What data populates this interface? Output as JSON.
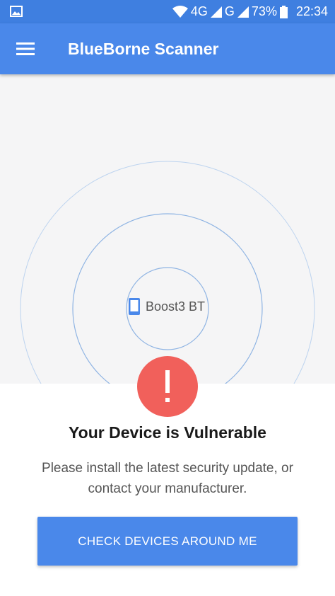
{
  "status_bar": {
    "network": "4G",
    "network2": "G",
    "battery": "73%",
    "time": "22:34",
    "icons": [
      "gallery-icon",
      "wifi-icon",
      "signal-icon",
      "battery-icon"
    ]
  },
  "app_bar": {
    "title": "BlueBorne Scanner",
    "menu_icon": "hamburger-menu-icon"
  },
  "radar": {
    "device_name": "Boost3 BT",
    "device_icon": "phone-icon"
  },
  "result": {
    "alert_icon": "exclamation-icon",
    "headline": "Your Device is Vulnerable",
    "message": "Please install the latest security update, or contact your manufacturer."
  },
  "action": {
    "check_label": "CHECK DEVICES AROUND ME"
  },
  "colors": {
    "status_bar": "#3f7fe0",
    "app_bar": "#4a88ea",
    "alert": "#f1605b",
    "radar_bg": "#f5f5f6",
    "ring": "#8fb4e3"
  }
}
